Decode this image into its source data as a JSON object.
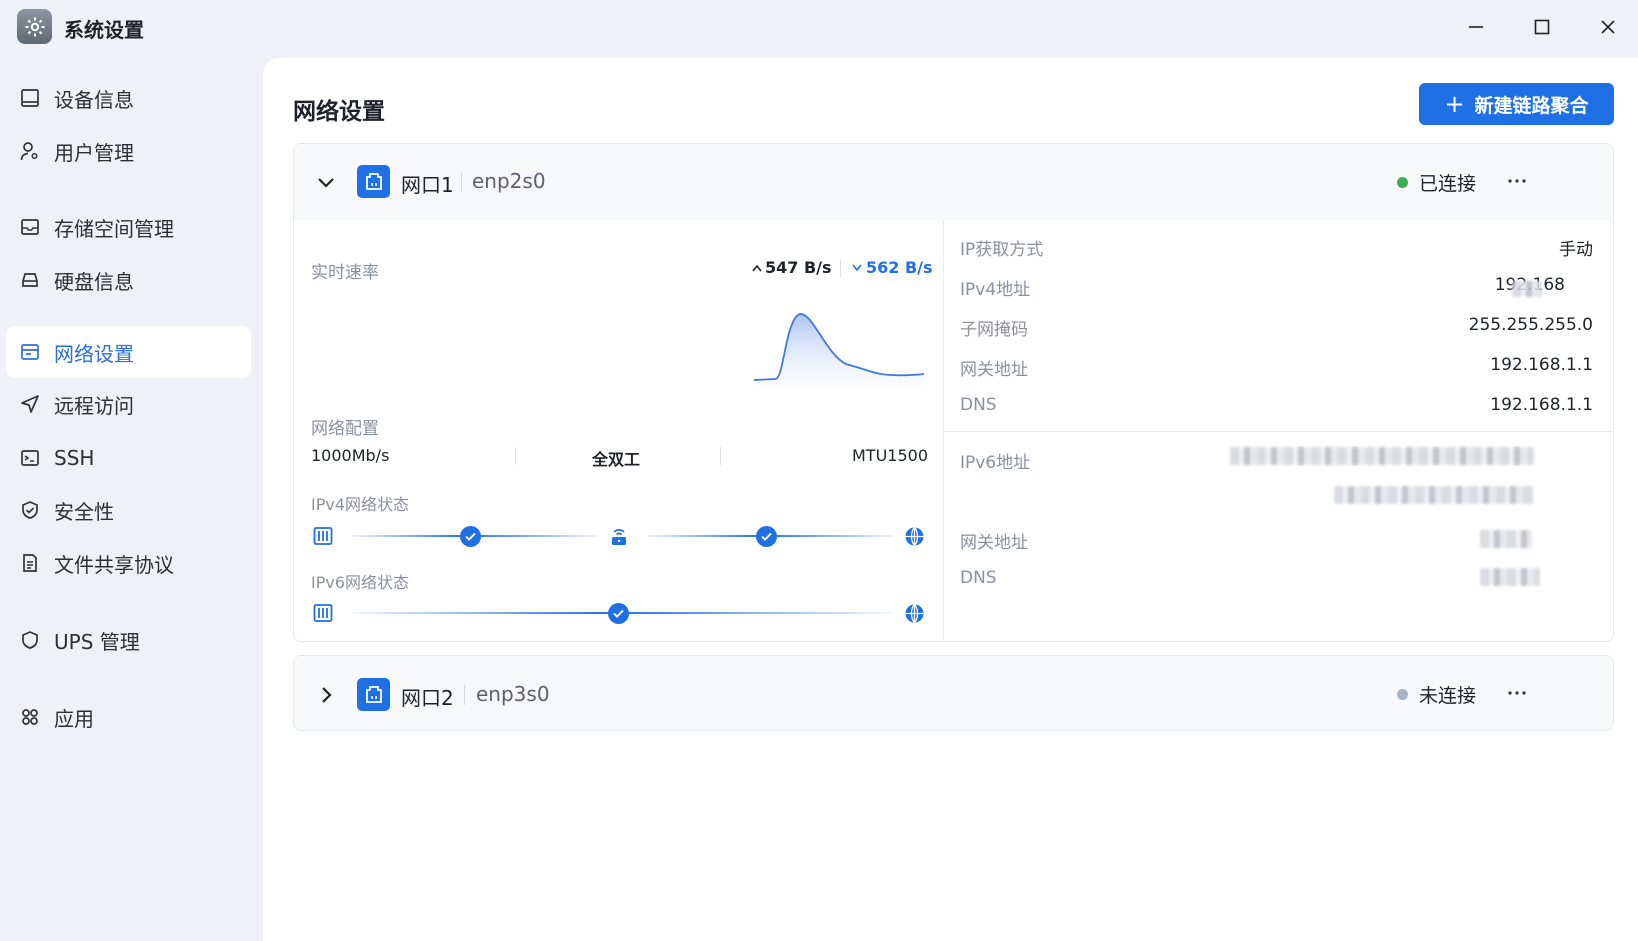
{
  "app": {
    "title": "系统设置"
  },
  "window": {
    "minimize_icon": "minimize-icon",
    "maximize_icon": "maximize-icon",
    "close_icon": "close-icon"
  },
  "sidebar": {
    "items": [
      {
        "label": "设备信息",
        "icon": "device-info-icon",
        "active": false
      },
      {
        "label": "用户管理",
        "icon": "user-gear-icon",
        "active": false
      },
      {
        "label": "存储空间管理",
        "icon": "storage-icon",
        "active": false
      },
      {
        "label": "硬盘信息",
        "icon": "hdd-icon",
        "active": false
      },
      {
        "label": "网络设置",
        "icon": "network-icon",
        "active": true
      },
      {
        "label": "远程访问",
        "icon": "send-icon",
        "active": false
      },
      {
        "label": "SSH",
        "icon": "terminal-icon",
        "active": false
      },
      {
        "label": "安全性",
        "icon": "shield-check-icon",
        "active": false
      },
      {
        "label": "文件共享协议",
        "icon": "file-icon",
        "active": false
      },
      {
        "label": "UPS 管理",
        "icon": "shield-icon",
        "active": false
      },
      {
        "label": "应用",
        "icon": "apps-icon",
        "active": false
      }
    ]
  },
  "main": {
    "title": "网络设置",
    "new_aggregation_button": "新建链路聚合",
    "colors": {
      "accent": "#1f6fe5",
      "connected": "#3dae52",
      "disconnected": "#a9b4c6"
    }
  },
  "port1": {
    "name": "网口1",
    "device": "enp2s0",
    "status": "已连接",
    "expanded": true,
    "speed": {
      "label": "实时速率",
      "upload": "547 B/s",
      "download": "562 B/s"
    },
    "config": {
      "label": "网络配置",
      "link_speed": "1000Mb/s",
      "duplex": "全双工",
      "mtu": "MTU1500"
    },
    "ipv4_status": {
      "label": "IPv4网络状态"
    },
    "ipv6_status": {
      "label": "IPv6网络状态"
    },
    "ipv4": {
      "method_label": "IP获取方式",
      "method": "手动",
      "address_label": "IPv4地址",
      "address": "192.168",
      "subnet_label": "子网掩码",
      "subnet": "255.255.255.0",
      "gateway_label": "网关地址",
      "gateway": "192.168.1.1",
      "dns_label": "DNS",
      "dns": "192.168.1.1"
    },
    "ipv6": {
      "address_label": "IPv6地址",
      "gateway_label": "网关地址",
      "dns_label": "DNS"
    }
  },
  "port2": {
    "name": "网口2",
    "device": "enp3s0",
    "status": "未连接",
    "expanded": false
  }
}
